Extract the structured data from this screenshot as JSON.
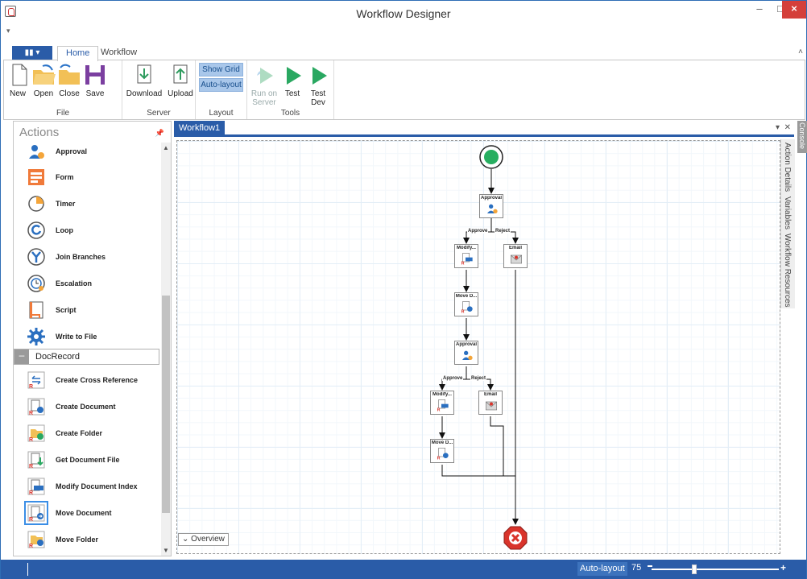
{
  "window": {
    "title": "Workflow Designer",
    "minimize": "–",
    "maximize": "□",
    "close": "×"
  },
  "ribbon": {
    "file_menu": "▮▮ ▾",
    "tabs": [
      "Home",
      "Workflow"
    ],
    "groups": {
      "file": {
        "label": "File",
        "buttons": [
          "New",
          "Open",
          "Close",
          "Save"
        ]
      },
      "server": {
        "label": "Server",
        "buttons": [
          "Download",
          "Upload"
        ]
      },
      "layout": {
        "label": "Layout",
        "show_grid": "Show Grid",
        "auto_layout": "Auto-layout"
      },
      "tools": {
        "label": "Tools",
        "run_on_server": "Run on Server",
        "test": "Test",
        "test_dev": "Test Dev"
      }
    }
  },
  "actions_panel": {
    "title": "Actions",
    "items": [
      {
        "label": "Approval",
        "icon": "approval-icon"
      },
      {
        "label": "Form",
        "icon": "form-icon"
      },
      {
        "label": "Timer",
        "icon": "timer-icon"
      },
      {
        "label": "Loop",
        "icon": "loop-icon"
      },
      {
        "label": "Join Branches",
        "icon": "join-branches-icon"
      },
      {
        "label": "Escalation",
        "icon": "escalation-icon"
      },
      {
        "label": "Script",
        "icon": "script-icon"
      },
      {
        "label": "Write to File",
        "icon": "gear-icon"
      }
    ],
    "section": "DocRecord",
    "doc_items": [
      {
        "label": "Create Cross Reference",
        "icon": "cross-reference-icon"
      },
      {
        "label": "Create Document",
        "icon": "create-document-icon"
      },
      {
        "label": "Create Folder",
        "icon": "create-folder-icon"
      },
      {
        "label": "Get Document File",
        "icon": "get-document-file-icon"
      },
      {
        "label": "Modify Document Index",
        "icon": "modify-index-icon"
      },
      {
        "label": "Move Document",
        "icon": "move-document-icon",
        "selected": true
      },
      {
        "label": "Move Folder",
        "icon": "move-folder-icon"
      }
    ]
  },
  "document": {
    "tab": "Workflow1",
    "overview": "Overview",
    "side_tabs": [
      "Action Details",
      "Variables",
      "Workflow Resources"
    ],
    "console": "Console",
    "flow": {
      "approval": "Approval",
      "modify": "Modify...",
      "move": "Move D...",
      "email": "Email",
      "approve_branch": "Approve",
      "reject_branch": "Reject"
    }
  },
  "status": {
    "auto_layout": "Auto-layout",
    "zoom": "75"
  },
  "colors": {
    "accent": "#2a5ca8",
    "start": "#27ae60",
    "end": "#d9342b"
  }
}
